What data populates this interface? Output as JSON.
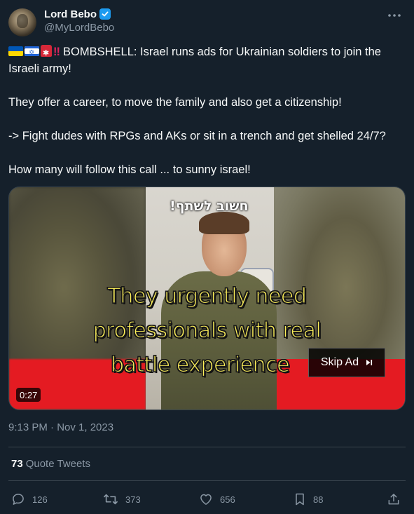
{
  "author": {
    "name": "Lord Bebo",
    "handle": "@MyLordBebo",
    "verified_color": "#1d9bf0"
  },
  "tweet": {
    "line1_emojis": [
      "ukraine-flag",
      "israel-flag",
      "siren",
      "double-exclamation"
    ],
    "line1": "BOMBSHELL: Israel runs ads for Ukrainian soldiers to join the Israeli army!",
    "line2": "They offer a career, to move the family and also get a citizenship!",
    "line3": "-> Fight dudes with RPGs and AKs or sit in a trench and get shelled 24/7?",
    "line4": "How many will follow this call ... to sunny israel!"
  },
  "video": {
    "hebrew_text": "חשוב לשתף!",
    "caption_1": "They urgently need",
    "caption_2": "professionals with real",
    "caption_3": "battle experience",
    "skip_ad_label": "Skip Ad",
    "duration": "0:27"
  },
  "meta": {
    "timestamp": "9:13 PM · Nov 1, 2023"
  },
  "quote_tweets": {
    "count": "73",
    "label": "Quote Tweets"
  },
  "actions": {
    "replies": "126",
    "retweets": "373",
    "likes": "656",
    "bookmarks": "88"
  },
  "colors": {
    "background": "#15202b",
    "text_primary": "#f7f9f9",
    "text_secondary": "#8b98a5",
    "divider": "#38444d",
    "caption_yellow": "#fff25a"
  }
}
